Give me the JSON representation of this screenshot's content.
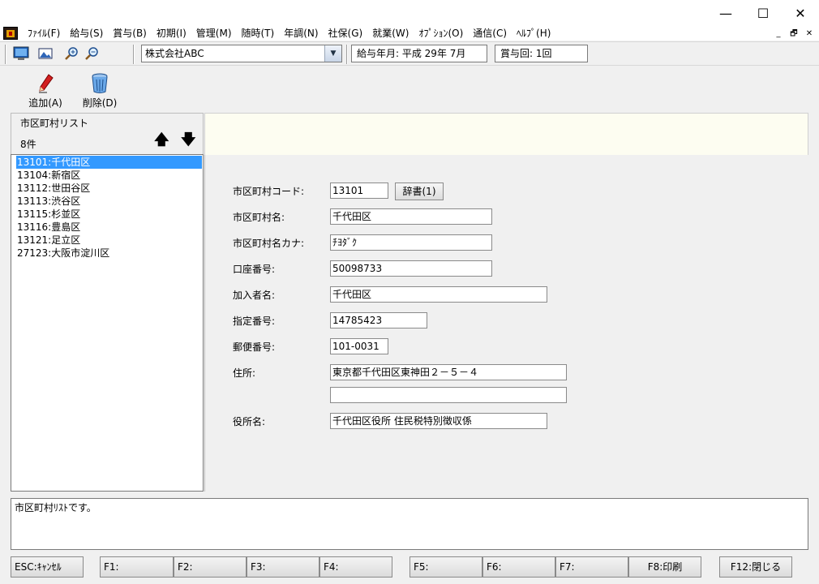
{
  "window": {
    "minimize": "—",
    "maximize": "☐",
    "close": "✕"
  },
  "menu": {
    "items": [
      "ﾌｧｲﾙ(F)",
      "給与(S)",
      "賞与(B)",
      "初期(I)",
      "管理(M)",
      "随時(T)",
      "年調(N)",
      "社保(G)",
      "就業(W)",
      "ｵﾌﾟｼｮﾝ(O)",
      "通信(C)",
      "ﾍﾙﾌﾟ(H)"
    ],
    "mdi_min": "_",
    "mdi_restore": "🗗",
    "mdi_close": "✕"
  },
  "toolbar": {
    "company": "株式会社ABC",
    "pay_period": "給与年月: 平成 29年  7月",
    "bonus_count": "賞与回: 1回",
    "icons": [
      "monitor-icon",
      "image-icon",
      "zoom-in-icon",
      "zoom-out-icon"
    ]
  },
  "actions": {
    "add": "追加(A)",
    "delete": "削除(D)"
  },
  "list": {
    "title": "市区町村リスト",
    "count": "8件",
    "up": "🡅",
    "down": "🡇",
    "items": [
      "13101:千代田区",
      "13104:新宿区",
      "13112:世田谷区",
      "13113:渋谷区",
      "13115:杉並区",
      "13116:豊島区",
      "13121:足立区",
      "27123:大阪市淀川区"
    ],
    "selected_index": 0
  },
  "form": {
    "code_label": "市区町村コード:",
    "code": "13101",
    "dict_button": "辞書(1)",
    "name_label": "市区町村名:",
    "name": "千代田区",
    "kana_label": "市区町村名カナ:",
    "kana": "ﾁﾖﾀﾞｸ",
    "account_label": "口座番号:",
    "account": "50098733",
    "subscriber_label": "加入者名:",
    "subscriber": "千代田区",
    "designated_label": "指定番号:",
    "designated": "14785423",
    "postal_label": "郵便番号:",
    "postal": "101-0031",
    "address_label": "住所:",
    "address1": "東京都千代田区東神田２－５－４",
    "address2": "",
    "office_label": "役所名:",
    "office": "千代田区役所 住民税特別徴収係"
  },
  "message": "市区町村ﾘｽﾄです。",
  "fkeys": {
    "esc": "ESC:ｷｬﾝｾﾙ",
    "f1": "F1:",
    "f2": "F2:",
    "f3": "F3:",
    "f4": "F4:",
    "f5": "F5:",
    "f6": "F6:",
    "f7": "F7:",
    "f8": "F8:印刷",
    "f12": "F12:閉じる"
  }
}
